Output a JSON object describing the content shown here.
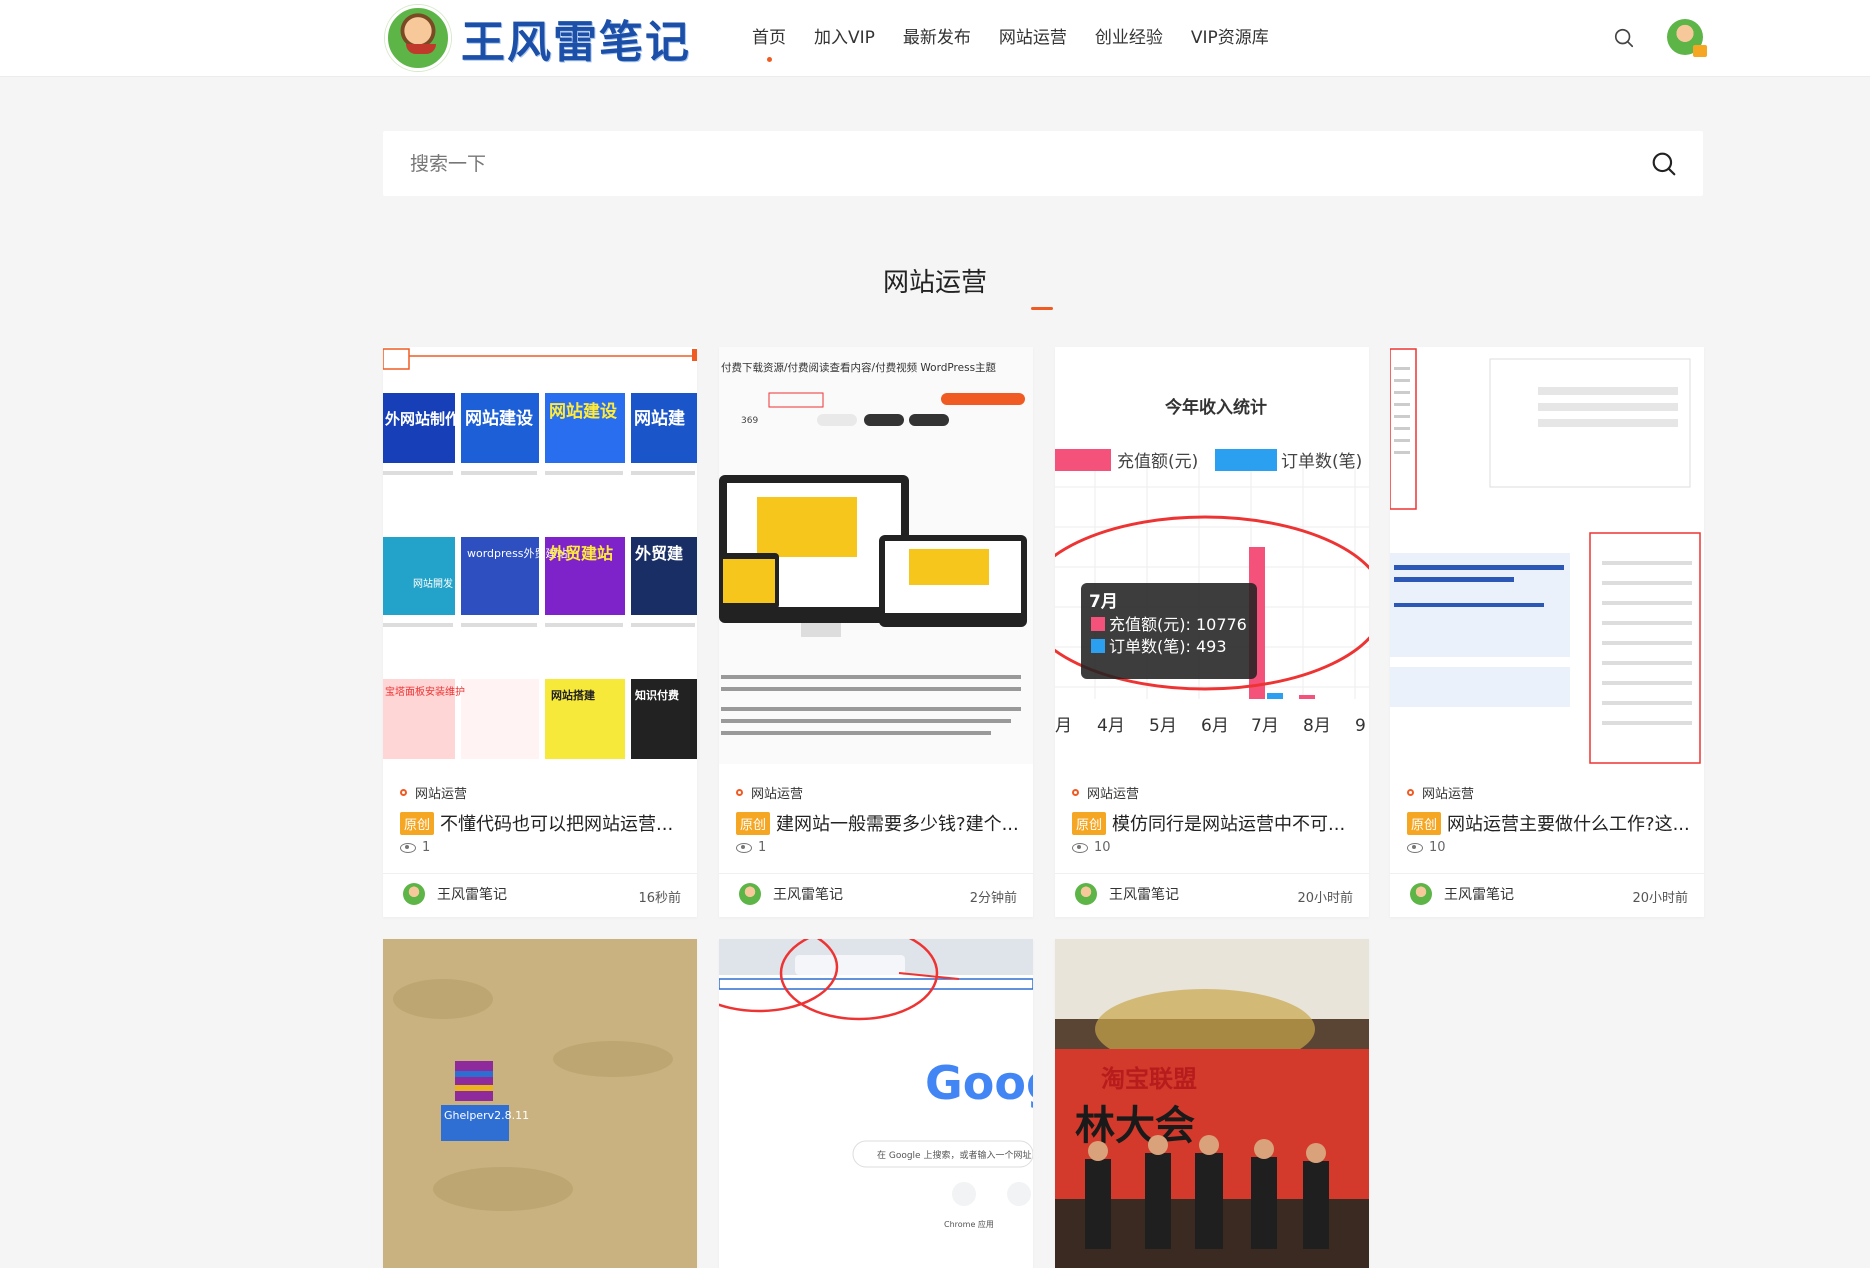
{
  "header": {
    "logo_text": "王风雷笔记",
    "nav": [
      {
        "label": "首页",
        "active": true
      },
      {
        "label": "加入VIP"
      },
      {
        "label": "最新发布"
      },
      {
        "label": "网站运营"
      },
      {
        "label": "创业经验"
      },
      {
        "label": "VIP资源库"
      }
    ]
  },
  "search": {
    "placeholder": "搜索一下"
  },
  "section": {
    "title": "网站运营"
  },
  "colors": {
    "accent": "#f05b24",
    "badge": "#f5a623",
    "logo": "#1b4fa8"
  },
  "cards": [
    {
      "category": "网站运营",
      "badge": "原创",
      "title": "不懂代码也可以把网站运营...",
      "views": "1",
      "author": "王风雷笔记",
      "time": "16秒前"
    },
    {
      "category": "网站运营",
      "badge": "原创",
      "title": "建网站一般需要多少钱?建个...",
      "views": "1",
      "author": "王风雷笔记",
      "time": "2分钟前"
    },
    {
      "category": "网站运营",
      "badge": "原创",
      "title": "模仿同行是网站运营中不可...",
      "views": "10",
      "author": "王风雷笔记",
      "time": "20小时前"
    },
    {
      "category": "网站运营",
      "badge": "原创",
      "title": "网站运营主要做什么工作?这...",
      "views": "10",
      "author": "王风雷笔记",
      "time": "20小时前"
    }
  ],
  "thumbs": {
    "t1": {
      "tiles": [
        "外网站制作",
        "网站建设",
        "网站建设",
        "网站建",
        "wordpress外贸建站",
        "外贸建站",
        "外贸建",
        "网站開发",
        "宝塔面板安装维护",
        "网站搭建",
        "知识付费"
      ]
    },
    "t2": {
      "heading": "付费下载资源/付费阅读查看内容/付费视频 WordPress主题",
      "count_text": "369"
    },
    "t3": {
      "title": "今年收入统计",
      "legend_a": "充值额(元)",
      "legend_b": "订单数(笔)",
      "tooltip_month": "7月",
      "tooltip_a": "充值额(元): 10776",
      "tooltip_b": "订单数(笔): 493",
      "months": [
        "月",
        "4月",
        "5月",
        "6月",
        "7月",
        "8月",
        "9"
      ]
    },
    "t5": {
      "file_label": "Ghelperv2.8.11"
    },
    "t6": {
      "logo": "Goog",
      "search_hint": "在 Google 上搜索，或者输入一个网址",
      "shortcut": "Chrome 应用"
    },
    "t7": {
      "banner": "淘宝联盟",
      "slogan": "林大会"
    }
  }
}
